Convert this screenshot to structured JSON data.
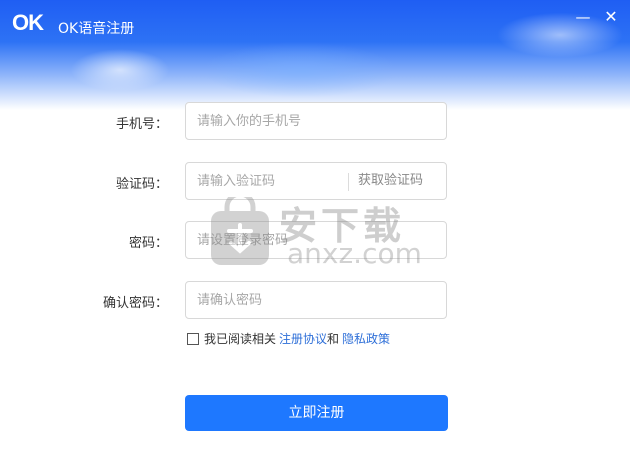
{
  "window": {
    "logo": "OK",
    "title": "OK语音注册",
    "minimize": "—",
    "close": "✕"
  },
  "form": {
    "phone": {
      "label": "手机号：",
      "placeholder": "请输入你的手机号"
    },
    "code": {
      "label": "验证码：",
      "placeholder": "请输入验证码",
      "action": "获取验证码"
    },
    "password": {
      "label": "密码：",
      "placeholder": "请设置登录密码"
    },
    "confirm": {
      "label": "确认密码：",
      "placeholder": "请确认密码"
    }
  },
  "agreement": {
    "prefix": "我已阅读相关",
    "terms": "注册协议",
    "and": "和",
    "privacy": "隐私政策",
    "checked": false
  },
  "submit_label": "立即注册",
  "watermark": {
    "text": "安下载",
    "sub": "anxz.com"
  },
  "colors": {
    "accent": "#1e78ff",
    "link": "#2e6fd8",
    "header": "#1f5ef3"
  }
}
